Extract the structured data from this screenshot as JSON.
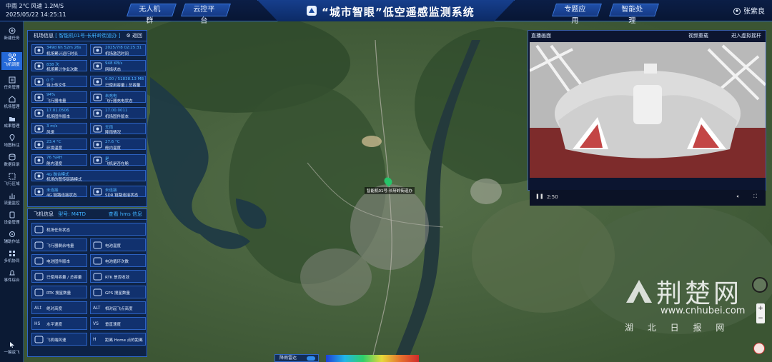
{
  "header": {
    "weather": "中雨 2℃ 风速 1.2M/S",
    "datetime": "2025/05/22 14:25:11",
    "title": "“城市智眼”低空遥感监测系统",
    "left_buttons": [
      "无人机群",
      "云控平台"
    ],
    "right_buttons": [
      "专题应用",
      "智能处理"
    ],
    "user": "张紫良"
  },
  "nav": {
    "items": [
      "新建任务",
      "飞机调度",
      "任务管理",
      "机场管理",
      "成果管理",
      "地图标注",
      "数据目录",
      "飞行区域",
      "流量监控",
      "设备管理",
      "辅助作战",
      "多机协同",
      "事件综合"
    ],
    "bottom": "一键返飞"
  },
  "airport_panel": {
    "title": "机场信息",
    "selected": "智能机01号-长轩岭街道办",
    "back": "返回",
    "cells": [
      {
        "value": "349d 6h 52m 26s",
        "label": "机场累计运行时长"
      },
      {
        "value": "2025/7/8 02:25:31",
        "label": "机场激活时间"
      },
      {
        "value": "838 次",
        "label": "机场累计作业次数"
      },
      {
        "value": "948 KB/s",
        "label": "网络状态"
      },
      {
        "value": "0 个",
        "label": "待上传文件"
      },
      {
        "value": "0.00 / 51838.13 MB",
        "label": "已使用容量 / 总容量"
      },
      {
        "value": "94%",
        "label": "飞行器电量"
      },
      {
        "value": "未充电",
        "label": "飞行器充电状态"
      },
      {
        "value": "17.01.0506",
        "label": "机场固件版本"
      },
      {
        "value": "17.00.0011",
        "label": "机场固件版本"
      },
      {
        "value": "3 m/s",
        "label": "风速"
      },
      {
        "value": "无雨",
        "label": "降雨情况"
      },
      {
        "value": "23.4 °C",
        "label": "环境温度"
      },
      {
        "value": "27.6 °C",
        "label": "舱内温度"
      },
      {
        "value": "76 %RH",
        "label": "舱内湿度"
      },
      {
        "value": "是",
        "label": "飞机是否在舱"
      }
    ],
    "wide_cell": {
      "value": "4G 融合模式",
      "label": "机场的图传链路模式"
    },
    "extra_cells": [
      {
        "value": "未连接",
        "label": "4G 链路连接状态"
      },
      {
        "value": "未连接",
        "label": "SDR 链路连接状态"
      }
    ]
  },
  "drone_panel": {
    "title": "飞机信息",
    "model": "型号: M4TD",
    "link": "查看 hms 信息",
    "cells": [
      "机场任务状态",
      "飞行器剩余电量",
      "电池温度",
      "电池固件版本",
      "电池循环次数",
      "已使用容量 / 总容量",
      "RTK 是否收敛",
      "RTK 搜星数量",
      "GPS 搜星数量",
      "绝对高度",
      "相对起飞点高度",
      "水平速度",
      "垂直速度",
      "飞机端风速",
      "距离 Home 点的距离"
    ],
    "icon_text": [
      "ALt",
      "ALT",
      "HS",
      "VS",
      "H"
    ]
  },
  "map": {
    "location_label": "智能机01号-长轩岭街道办"
  },
  "video": {
    "title": "直播画面",
    "btn1": "视频重载",
    "btn2": "进入虚拟摇杆",
    "time": "2:50"
  },
  "watermark": {
    "brand": "荆楚网",
    "url": "www.cnhubei.com",
    "sub": "湖 北 日 报 网"
  },
  "bottom": {
    "toggle": "降雨雷达"
  }
}
